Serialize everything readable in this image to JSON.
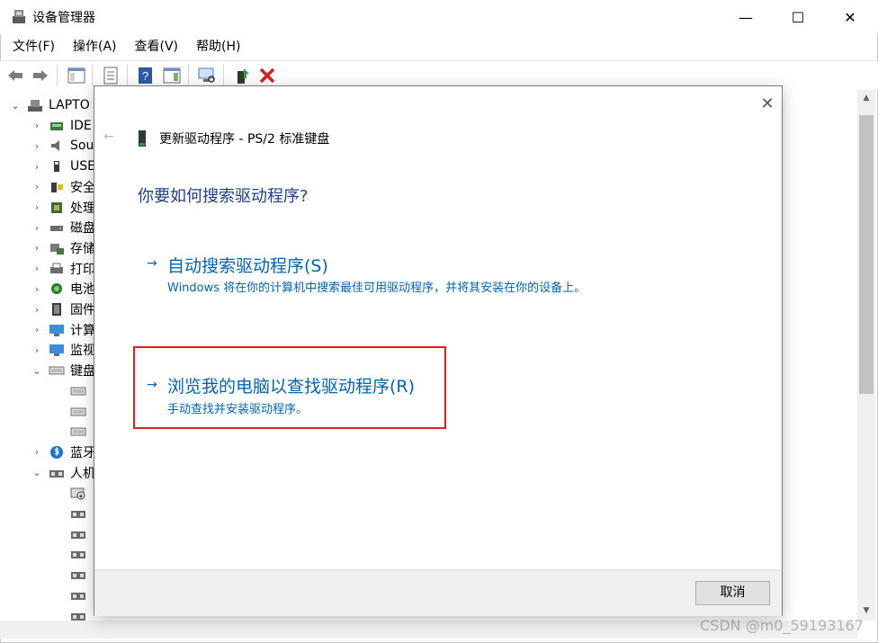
{
  "window": {
    "title": "设备管理器",
    "controls": {
      "minimize": "—",
      "maximize": "☐",
      "close": "✕"
    }
  },
  "menu": [
    "文件(F)",
    "操作(A)",
    "查看(V)",
    "帮助(H)"
  ],
  "toolbar_icons": [
    "back-arrow-icon",
    "forward-arrow-icon",
    "show-hide-console-tree-icon",
    "properties-icon",
    "help-icon",
    "action-pane-icon",
    "scan-hardware-icon",
    "update-driver-icon",
    "uninstall-device-icon"
  ],
  "tree": {
    "root": "LAPTO",
    "items": [
      {
        "label": "IDE",
        "expanded": false,
        "icon": "ide-controller-icon"
      },
      {
        "label": "Sou",
        "expanded": false,
        "icon": "speaker-icon"
      },
      {
        "label": "USE",
        "expanded": false,
        "icon": "usb-icon"
      },
      {
        "label": "安全",
        "expanded": false,
        "icon": "security-device-icon"
      },
      {
        "label": "处理",
        "expanded": false,
        "icon": "processor-icon"
      },
      {
        "label": "磁盘",
        "expanded": false,
        "icon": "disk-drive-icon"
      },
      {
        "label": "存储",
        "expanded": false,
        "icon": "storage-controller-icon"
      },
      {
        "label": "打印",
        "expanded": false,
        "icon": "printer-icon"
      },
      {
        "label": "电池",
        "expanded": false,
        "icon": "battery-icon"
      },
      {
        "label": "固件",
        "expanded": false,
        "icon": "firmware-icon"
      },
      {
        "label": "计算",
        "expanded": false,
        "icon": "computer-icon"
      },
      {
        "label": "监视",
        "expanded": false,
        "icon": "monitor-icon"
      },
      {
        "label": "键盘",
        "expanded": true,
        "icon": "keyboard-icon"
      },
      {
        "label": "",
        "child": true,
        "icon": "keyboard-device-icon"
      },
      {
        "label": "",
        "child": true,
        "icon": "keyboard-device-icon"
      },
      {
        "label": "",
        "child": true,
        "icon": "keyboard-device-icon"
      },
      {
        "label": "蓝牙",
        "expanded": false,
        "icon": "bluetooth-icon"
      },
      {
        "label": "人机",
        "expanded": true,
        "icon": "hid-icon"
      },
      {
        "label": "",
        "child": true,
        "icon": "hid-device-disabled-icon"
      },
      {
        "label": "",
        "child": true,
        "icon": "hid-device-icon"
      },
      {
        "label": "",
        "child": true,
        "icon": "hid-device-icon"
      },
      {
        "label": "",
        "child": true,
        "icon": "hid-device-icon"
      },
      {
        "label": "",
        "child": true,
        "icon": "hid-device-icon"
      },
      {
        "label": "",
        "child": true,
        "icon": "hid-device-icon"
      },
      {
        "label": "",
        "child": true,
        "icon": "hid-device-icon"
      }
    ]
  },
  "dialog": {
    "back": "←",
    "close": "✕",
    "title": "更新驱动程序 - PS/2 标准键盘",
    "question": "你要如何搜索驱动程序?",
    "option1": {
      "arrow": "→",
      "title": "自动搜索驱动程序(S)",
      "desc": "Windows 将在你的计算机中搜索最佳可用驱动程序，并将其安装在你的设备上。"
    },
    "option2": {
      "arrow": "→",
      "title": "浏览我的电脑以查找驱动程序(R)",
      "desc": "手动查找并安装驱动程序。"
    },
    "cancel": "取消"
  },
  "watermark": "CSDN @m0_59193167",
  "colors": {
    "link": "#0066b4",
    "heading": "#1f3f8f",
    "highlight": "#e0201b"
  }
}
